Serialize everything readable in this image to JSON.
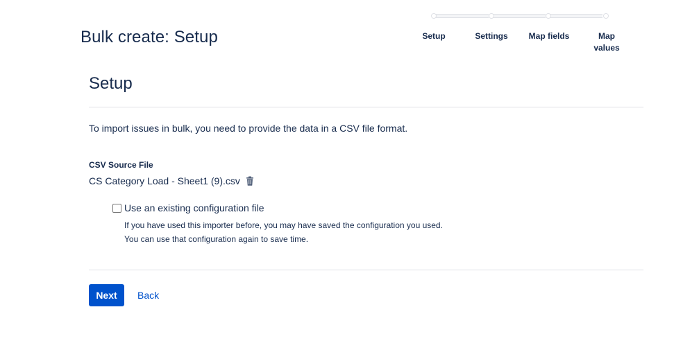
{
  "header": {
    "title": "Bulk create: Setup"
  },
  "tracker": {
    "steps": [
      {
        "label": "Setup"
      },
      {
        "label": "Settings"
      },
      {
        "label": "Map fields"
      },
      {
        "label": "Map values"
      }
    ]
  },
  "section": {
    "title": "Setup",
    "intro": "To import issues in bulk, you need to provide the data in a CSV file format."
  },
  "csv": {
    "label": "CSV Source File",
    "filename": "CS Category Load - Sheet1 (9).csv",
    "delete_icon": "trash-icon"
  },
  "config": {
    "checkbox_label": "Use an existing configuration file",
    "checked": false,
    "help_line1": "If you have used this importer before, you may have saved the configuration you used.",
    "help_line2": "You can use that configuration again to save time."
  },
  "actions": {
    "next_label": "Next",
    "back_label": "Back"
  },
  "colors": {
    "primary": "#0052cc",
    "text": "#172b4d",
    "divider": "#dfe1e6"
  }
}
